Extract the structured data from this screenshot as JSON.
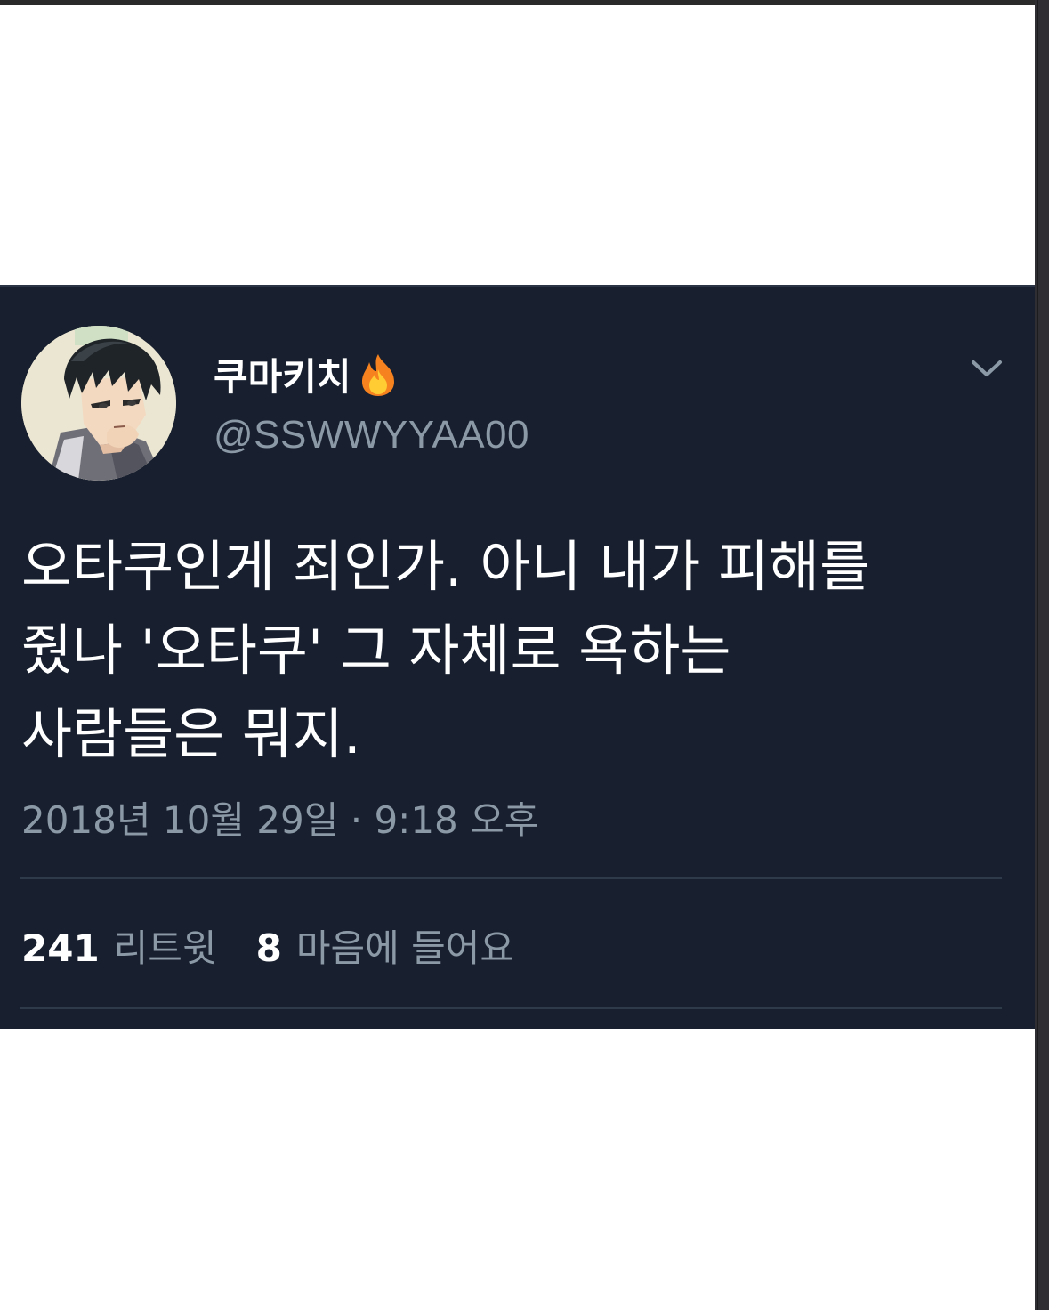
{
  "tweet": {
    "display_name": "쿠마키치",
    "name_emoji_icon": "fire-icon",
    "handle": "@SSWWYYAA00",
    "menu_icon": "chevron-down-icon",
    "avatar_icon": "anime-character-avatar",
    "text_lines": [
      "오타쿠인게 죄인가. 아니 내가 피해를",
      "줬나 '오타쿠' 그 자체로 욕하는",
      "사람들은 뭐지."
    ],
    "timestamp": "2018년 10월 29일 · 9:18 오후",
    "retweet_count": "241",
    "retweet_label": "리트윗",
    "like_count": "8",
    "like_label": "마음에 들어요"
  },
  "colors": {
    "card_background": "#18202f",
    "primary_text": "#ffffff",
    "secondary_text": "#8b98a5",
    "divider": "#2e394a",
    "page_background": "#ffffff"
  }
}
